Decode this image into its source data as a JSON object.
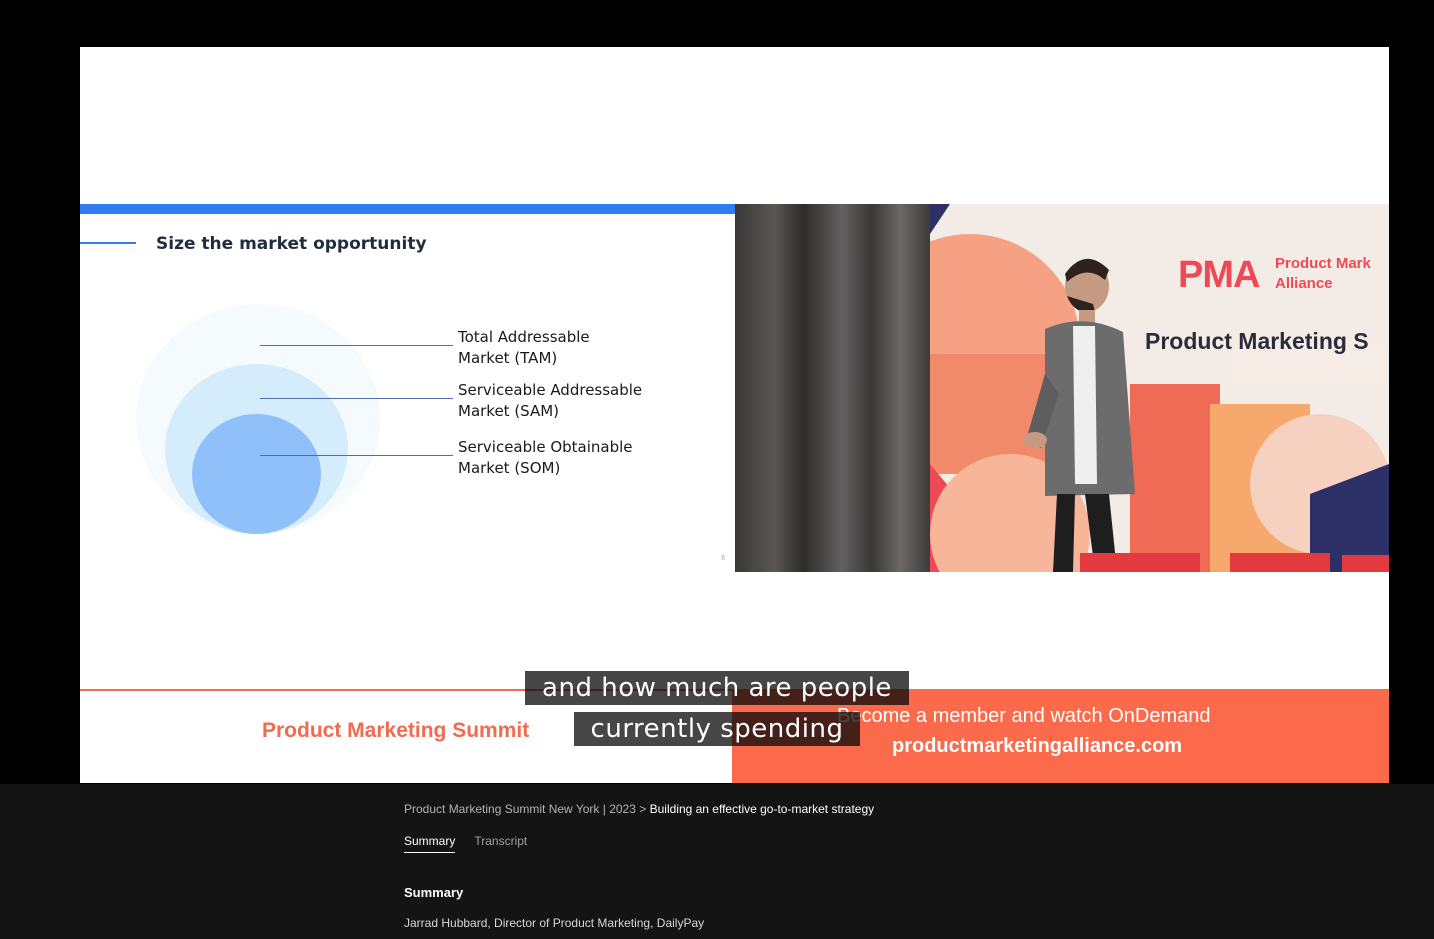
{
  "slide": {
    "title": "Size the market opportunity",
    "labels": [
      {
        "line1": "Total Addressable",
        "line2": "Market (TAM)"
      },
      {
        "line1": "Serviceable Addressable",
        "line2": "Market (SAM)"
      },
      {
        "line1": "Serviceable Obtainable",
        "line2": "Market (SOM)"
      }
    ],
    "page_number": "8",
    "colors": {
      "bar": "#2f7cf0",
      "tam": "#f5fafd",
      "sam": "#d5ecfc",
      "som": "#90c0fa"
    }
  },
  "camera": {
    "logo": "PMA",
    "brand_line1": "Product Mark",
    "brand_line2": "Alliance",
    "backdrop_text": "Product Marketing S"
  },
  "banner": {
    "left_title": "Product Marketing Summit",
    "cta": "Become a member and watch OnDemand",
    "url": "productmarketingalliance.com",
    "colors": {
      "accent": "#fa6a4b"
    }
  },
  "captions": {
    "line1": "and how much are people",
    "line2": "currently spending"
  },
  "page": {
    "breadcrumb_parent": "Product Marketing Summit New York | 2023",
    "breadcrumb_sep": ">",
    "breadcrumb_current": "Building an effective go-to-market strategy",
    "tabs": [
      {
        "label": "Summary",
        "active": true
      },
      {
        "label": "Transcript",
        "active": false
      }
    ],
    "summary_heading": "Summary",
    "speaker": "Jarrad Hubbard, Director of Product Marketing, DailyPay"
  }
}
